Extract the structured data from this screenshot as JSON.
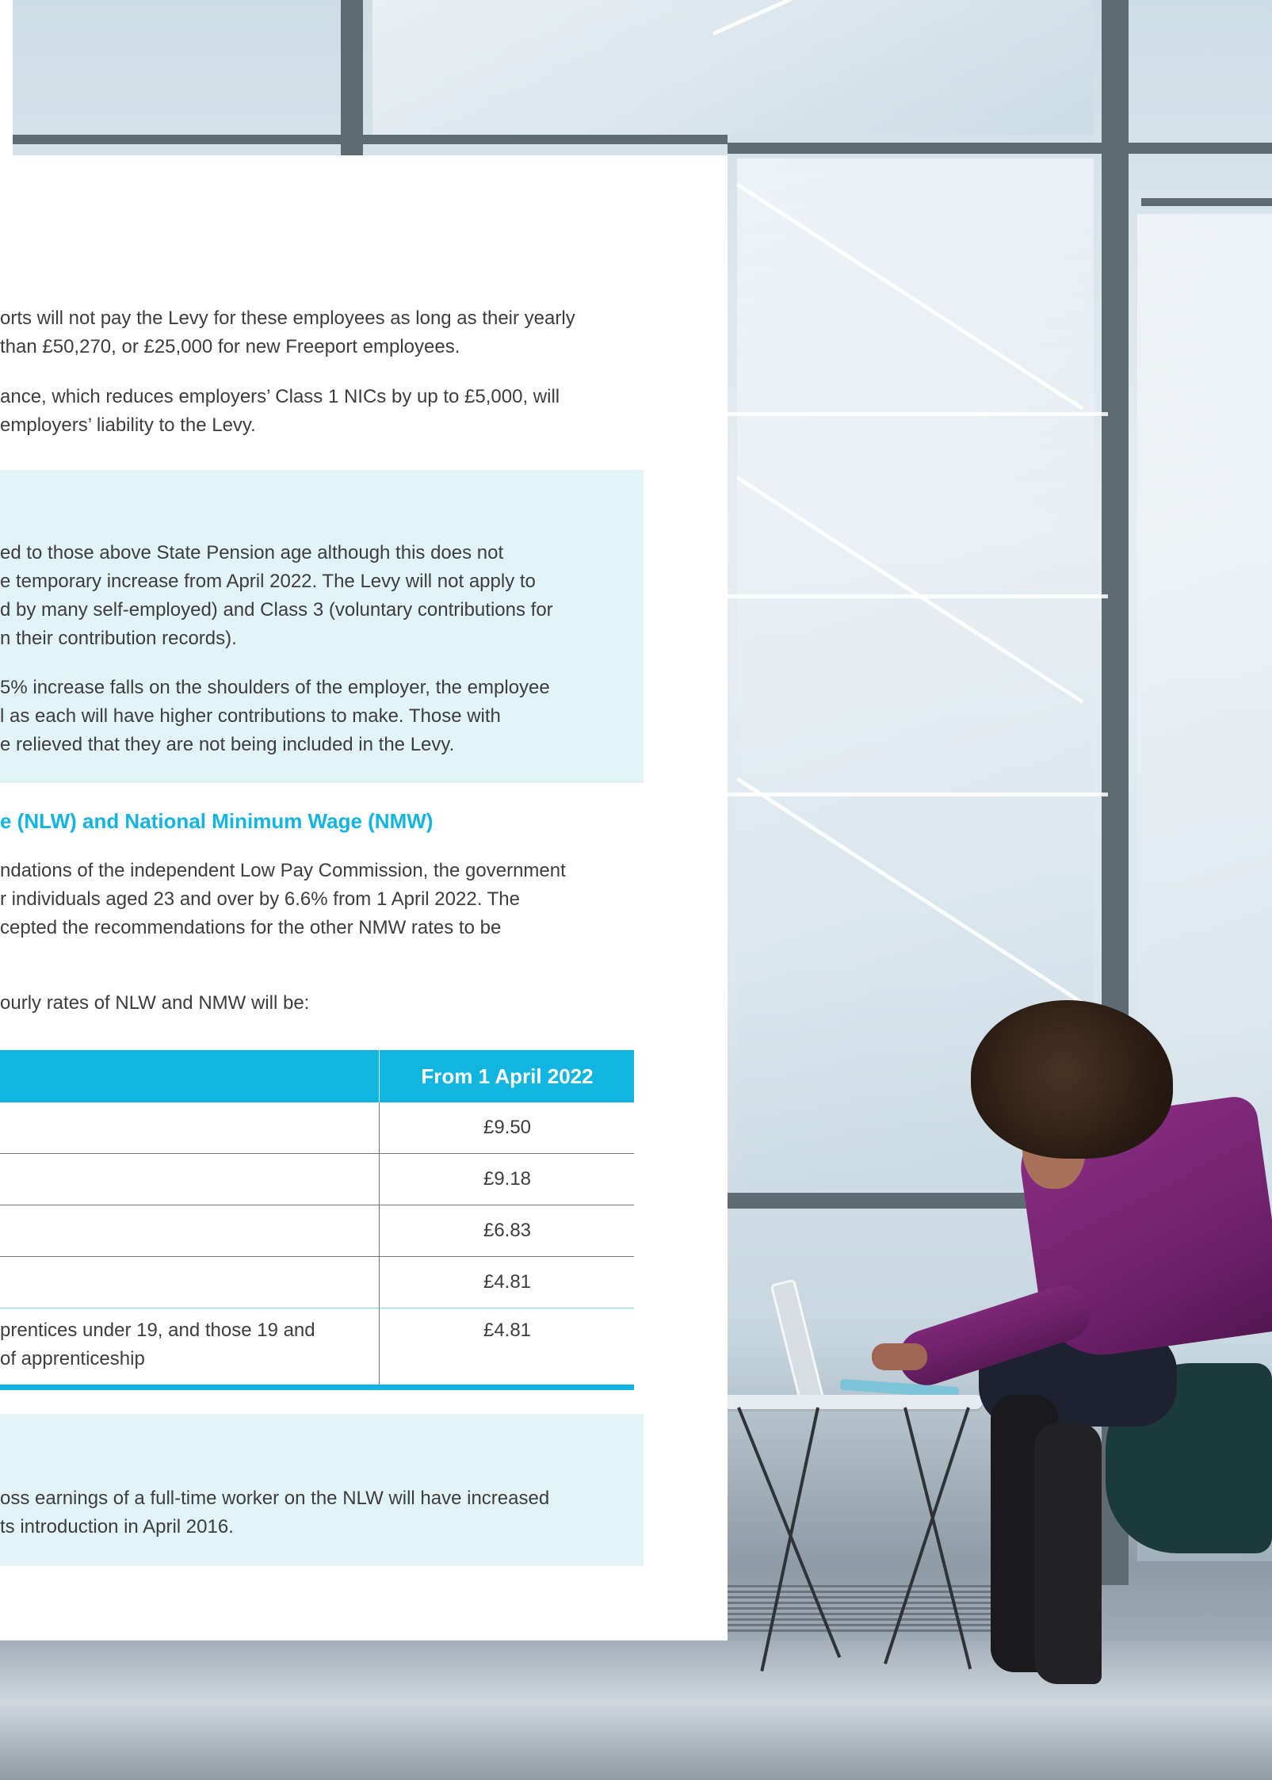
{
  "intro": {
    "lines": [
      "orts will not pay the Levy for these employees as long as their yearly",
      "than £50,270, or £25,000 for new Freeport employees.",
      "ance, which reduces employers’ Class 1 NICs by up to £5,000, will",
      "employers’ liability to the Levy."
    ]
  },
  "box1": {
    "lines": [
      "ed to those above State Pension age although this does not",
      "e temporary increase from April 2022. The Levy will not apply to",
      "d by many self-employed) and Class 3 (voluntary contributions for",
      "n their contribution records).",
      "5% increase falls on the shoulders of the employer, the employee",
      "l as each will have higher contributions to make. Those with",
      "e relieved that they are not being included in the Levy."
    ]
  },
  "nlw_section": {
    "heading": "e (NLW) and National Minimum Wage (NMW)",
    "lines": [
      "ndations of the independent Low Pay Commission, the government",
      "r individuals aged 23 and over by 6.6% from 1 April 2022. The",
      "cepted the recommendations for the other NMW rates to be",
      "ourly rates of NLW and NMW will be:"
    ]
  },
  "rates_table": {
    "header": "From 1 April 2022",
    "rows": [
      {
        "label": "",
        "value": "£9.50"
      },
      {
        "label": "",
        "value": "£9.18"
      },
      {
        "label": "",
        "value": "£6.83"
      },
      {
        "label": "",
        "value": "£4.81"
      },
      {
        "label_line1": "prentices under 19, and those 19 and",
        "label_line2": "of apprenticeship",
        "value": "£4.81"
      }
    ]
  },
  "box2": {
    "lines": [
      "oss earnings of a full-time worker on the NLW will have increased",
      "ts introduction in April 2016."
    ]
  },
  "colors": {
    "accent": "#12b4e0",
    "tint": "#e2f4f8",
    "text": "#3d3d3d"
  }
}
